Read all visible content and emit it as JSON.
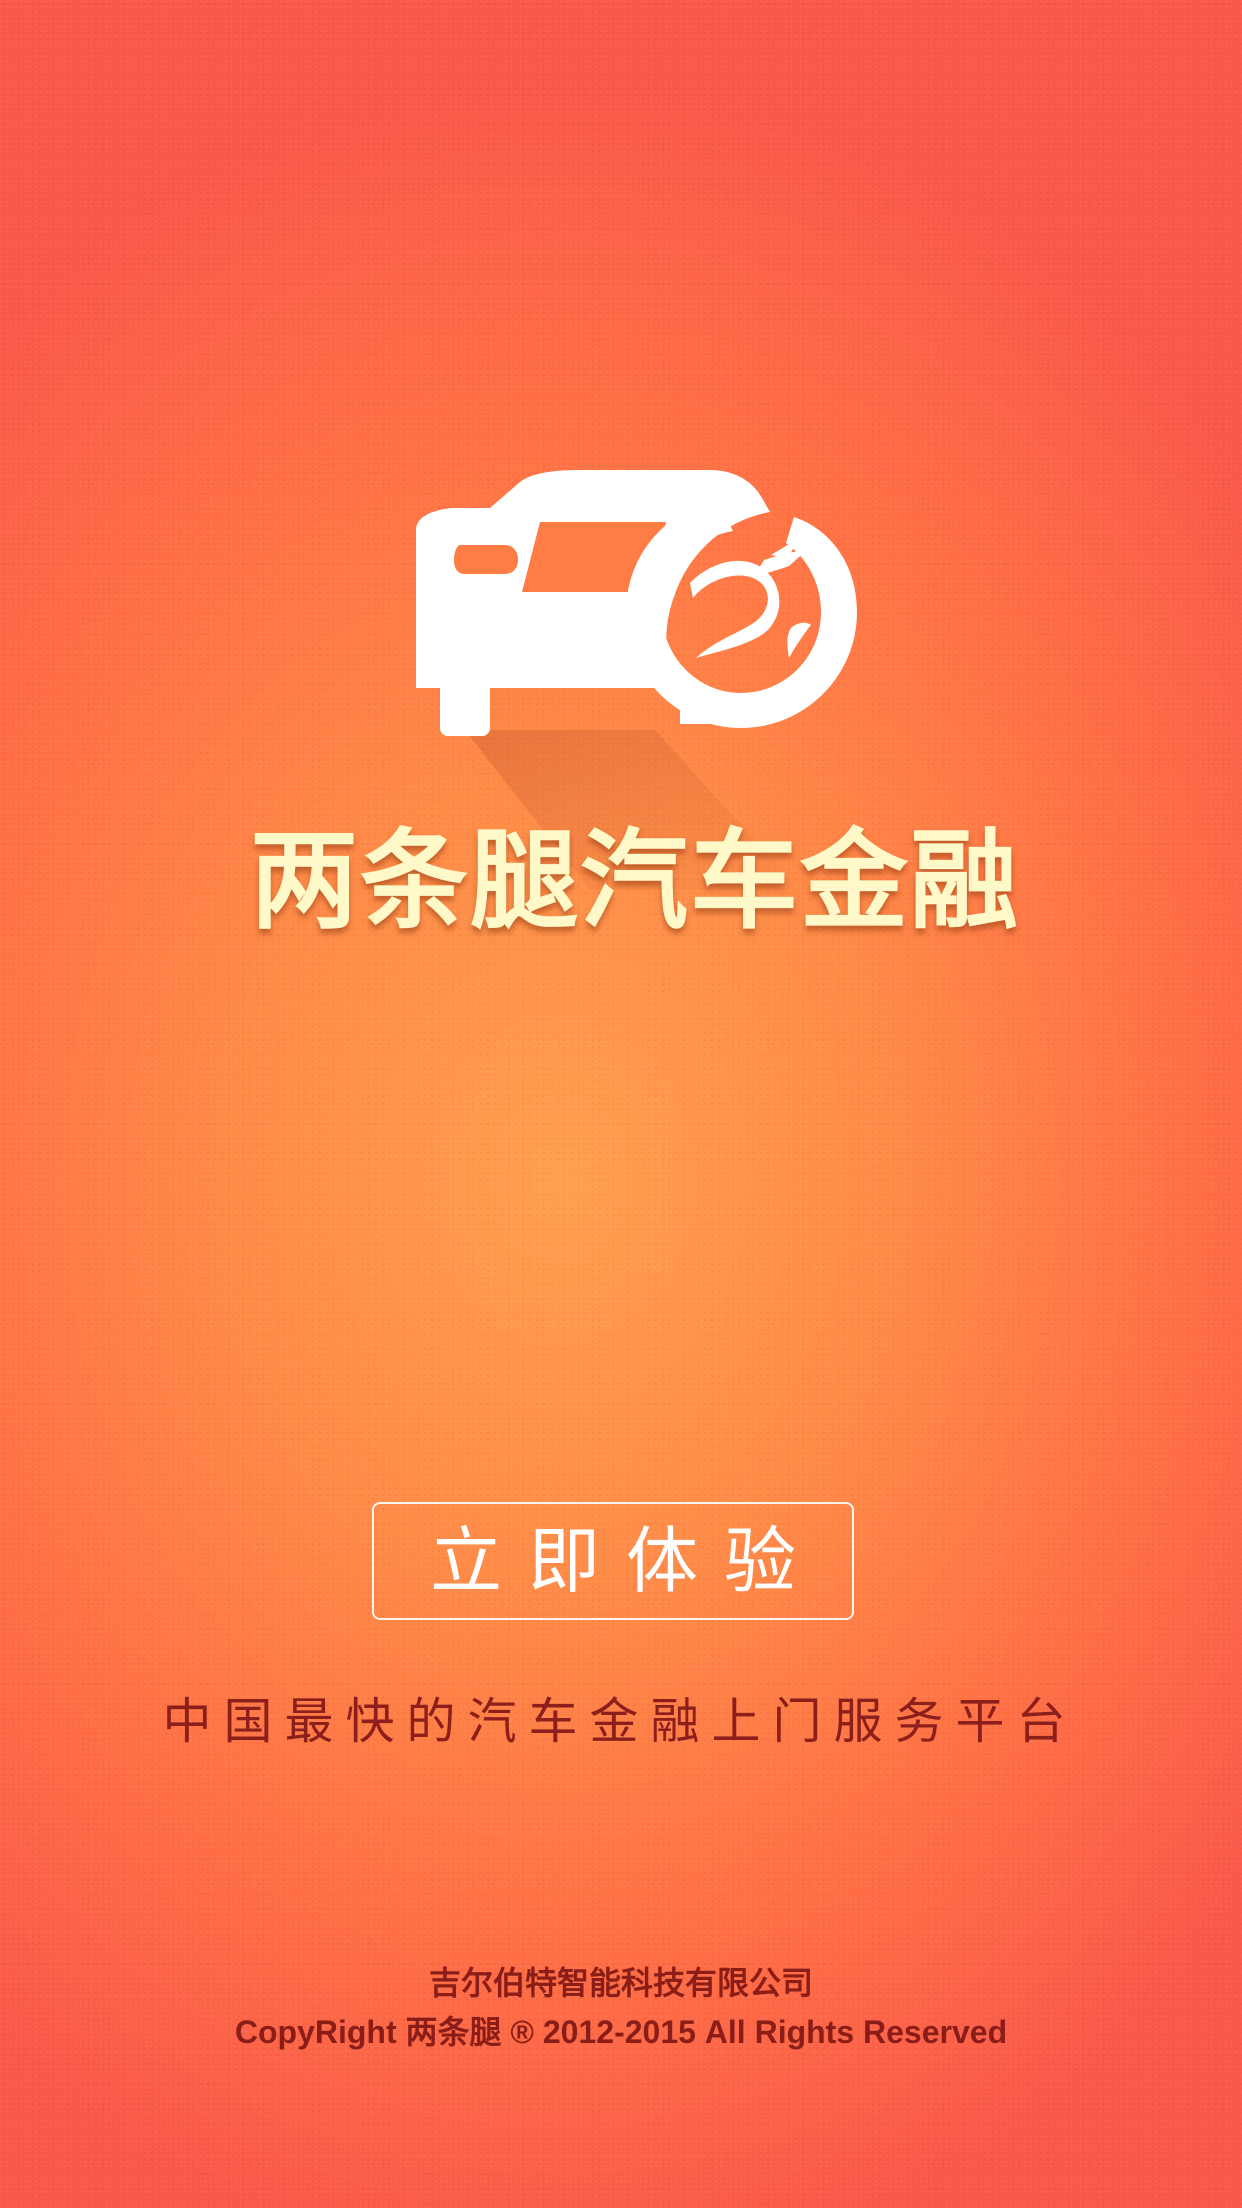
{
  "app": {
    "logo_icon": "car-wheel-logo-icon",
    "brand_name": "两条腿汽车金融"
  },
  "cta": {
    "label": "立即体验"
  },
  "slogan": "中国最快的汽车金融上门服务平台",
  "footer": {
    "company": "吉尔伯特智能科技有限公司",
    "copyright": "CopyRight 两条腿 ® 2012-2015 All Rights Reserved"
  },
  "colors": {
    "background_center": "#ff9f4f",
    "background_edge": "#f9584a",
    "brand_text": "#fff8c8",
    "footer_text": "#8a1d18",
    "button_border": "#ffffff"
  }
}
